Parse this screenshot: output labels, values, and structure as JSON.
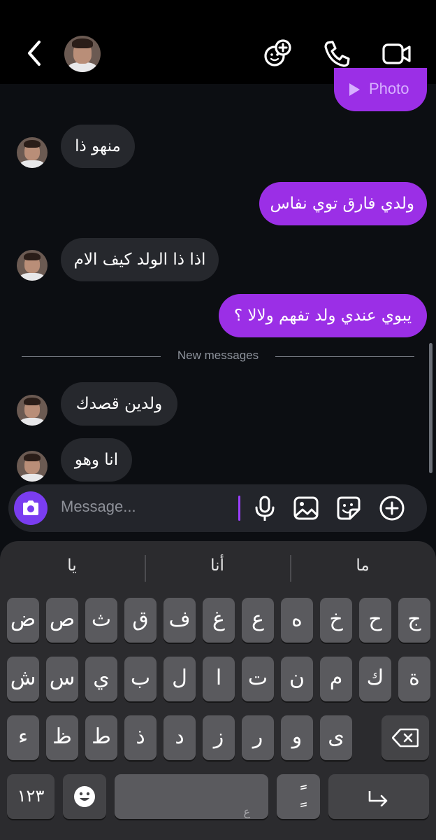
{
  "header": {
    "back_icon": "chevron-left-icon",
    "avatar": "contact-avatar",
    "actions": [
      "effects-icon",
      "phone-icon",
      "video-icon"
    ]
  },
  "messages": [
    {
      "side": "out",
      "kind": "photo",
      "label": "Photo"
    },
    {
      "side": "in",
      "text": "منهو ذا"
    },
    {
      "side": "out",
      "text": "ولدي فارق توي نفاس"
    },
    {
      "side": "in",
      "text": "اذا ذا الولد كيف الام"
    },
    {
      "side": "out",
      "text": "يبوي عندي ولد تفهم ولالا ؟"
    },
    {
      "side": "in",
      "text": "ولدين قصدك"
    },
    {
      "side": "in",
      "text": "انا وهو"
    }
  ],
  "separator": {
    "text": "New messages"
  },
  "composer": {
    "placeholder": "Message...",
    "icons": [
      "camera-icon",
      "microphone-icon",
      "gallery-icon",
      "sticker-icon",
      "plus-icon"
    ]
  },
  "keyboard": {
    "suggestions": [
      "يا",
      "أنا",
      "ما"
    ],
    "row1": [
      "ض",
      "ص",
      "ث",
      "ق",
      "ف",
      "غ",
      "ع",
      "ه",
      "خ",
      "ح",
      "ج"
    ],
    "row2": [
      "ش",
      "س",
      "ي",
      "ب",
      "ل",
      "ا",
      "ت",
      "ن",
      "م",
      "ك",
      "ة"
    ],
    "row3": [
      "ء",
      "ظ",
      "ط",
      "ذ",
      "د",
      "ز",
      "ر",
      "و",
      "ى"
    ],
    "numbers_key": "١٢٣",
    "space_hint": "ع",
    "diacritic_key": "ًٍ",
    "icons": [
      "backspace-icon",
      "emoji-icon",
      "return-icon"
    ]
  },
  "colors": {
    "outgoing": "#9b2fe6",
    "incoming": "#26282d",
    "background": "#0c0e12",
    "accent": "#7a3df0"
  }
}
